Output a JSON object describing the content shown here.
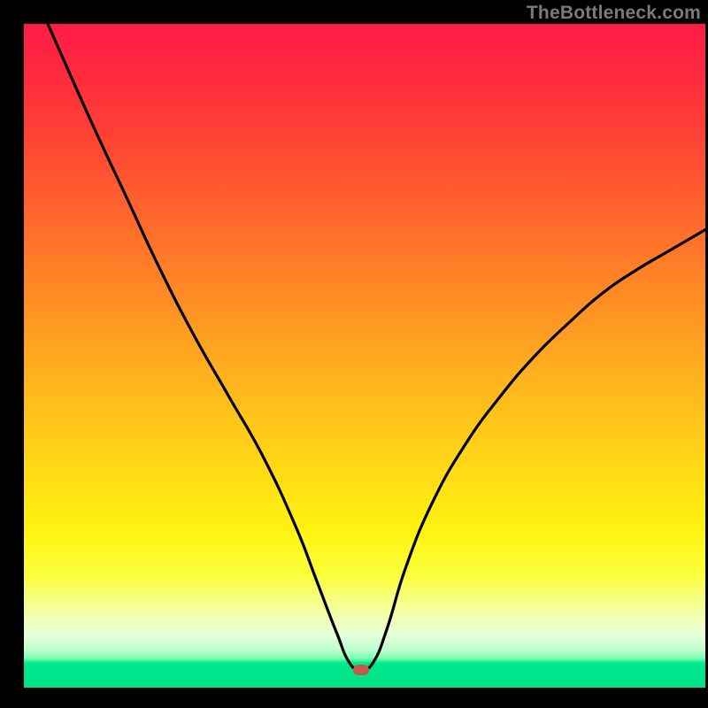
{
  "watermark": "TheBottleneck.com",
  "marker": {
    "x_pct": 49.5,
    "y_pct": 97.3
  },
  "chart_data": {
    "type": "line",
    "title": "",
    "xlabel": "",
    "ylabel": "",
    "xlim": [
      0,
      100
    ],
    "ylim": [
      0,
      100
    ],
    "series": [
      {
        "name": "bottleneck-curve",
        "x": [
          3.5,
          10,
          15,
          20,
          25,
          30,
          35,
          40,
          43,
          46,
          48,
          49.5,
          51,
          53,
          56,
          60,
          65,
          70,
          75,
          80,
          85,
          90,
          95,
          100
        ],
        "y": [
          100,
          85,
          74,
          63,
          53,
          44,
          35,
          24,
          16,
          8,
          3.4,
          2.7,
          3.4,
          8,
          18,
          28,
          37,
          44,
          50,
          55,
          59.5,
          63,
          66,
          69
        ]
      }
    ],
    "gradient_stops": [
      {
        "pct": 0,
        "color": "#ff1b47"
      },
      {
        "pct": 8,
        "color": "#ff2b3d"
      },
      {
        "pct": 18,
        "color": "#ff4534"
      },
      {
        "pct": 30,
        "color": "#ff6a2c"
      },
      {
        "pct": 42,
        "color": "#ff8f24"
      },
      {
        "pct": 54,
        "color": "#ffb41d"
      },
      {
        "pct": 66,
        "color": "#ffd716"
      },
      {
        "pct": 76,
        "color": "#fff20f"
      },
      {
        "pct": 83,
        "color": "#fbff3a"
      },
      {
        "pct": 89,
        "color": "#f3ffad"
      },
      {
        "pct": 92,
        "color": "#e6ffd9"
      },
      {
        "pct": 94.3,
        "color": "#bfffcf"
      },
      {
        "pct": 95.6,
        "color": "#7affae"
      },
      {
        "pct": 96.3,
        "color": "#00e98e"
      },
      {
        "pct": 100,
        "color": "#00e089"
      }
    ]
  }
}
